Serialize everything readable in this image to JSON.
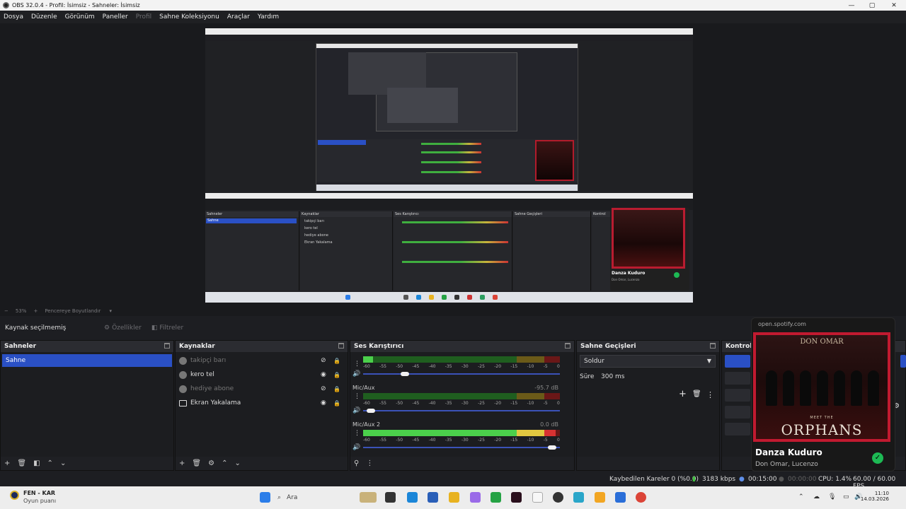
{
  "window": {
    "title": "OBS 32.0.4 - Profil: İsimsiz - Sahneler: İsimsiz",
    "min": "—",
    "max": "▢",
    "close": "✕"
  },
  "menu": [
    "Dosya",
    "Düzenle",
    "Görünüm",
    "Paneller",
    "Profil",
    "Sahne Koleksiyonu",
    "Araçlar",
    "Yardım"
  ],
  "zoom": {
    "minus": "−",
    "value": "53%",
    "plus": "+",
    "fit": "Pencereye Boyutlandır"
  },
  "source_bar": {
    "label": "Kaynak seçilmemiş",
    "properties": "Özellikler",
    "filters": "Filtreler"
  },
  "scenes": {
    "title": "Sahneler",
    "items": [
      "Sahne"
    ]
  },
  "sources": {
    "title": "Kaynaklar",
    "items": [
      {
        "name": "takipçi barı",
        "visible": false
      },
      {
        "name": "kero tel",
        "visible": true
      },
      {
        "name": "hediye abone",
        "visible": false
      },
      {
        "name": "Ekran Yakalama",
        "visible": true
      }
    ]
  },
  "mixer": {
    "title": "Ses Karıştırıcı",
    "ticks": [
      "-60",
      "-55",
      "-50",
      "-45",
      "-40",
      "-35",
      "-30",
      "-25",
      "-20",
      "-15",
      "-10",
      "-5",
      "0"
    ],
    "channels": [
      {
        "name": "",
        "value": "",
        "level": 0.05,
        "volume": 0.2
      },
      {
        "name": "Mic/Aux",
        "value": "-95.7 dB",
        "level": 0.0,
        "volume": 0.02
      },
      {
        "name": "Mic/Aux 2",
        "value": "0.0 dB",
        "level": 0.98,
        "volume": 0.98
      }
    ]
  },
  "transitions": {
    "title": "Sahne Geçişleri",
    "selected": "Soldur",
    "duration_label": "Süre",
    "duration_value": "300 ms"
  },
  "controls": {
    "title": "Kontrol"
  },
  "status": {
    "dropped": "Kaybedilen Kareler 0 (%0.0)",
    "bitrate": "3183 kbps",
    "rec_time": "00:15:00",
    "stream_time": "00:00:00",
    "cpu": "CPU: 1.4%",
    "fps": "60.00 / 60.00 FPS"
  },
  "taskbar": {
    "widget_title": "FEN - KAR",
    "widget_sub": "Oyun puanı",
    "search": "Ara",
    "time": "11:10",
    "date": "14.03.2026"
  },
  "spotify": {
    "url": "open.spotify.com",
    "song": "Danza Kuduro",
    "artist": "Don Omar, Lucenzo",
    "album_top": "DON OMAR",
    "album_sub": "MEET THE",
    "album_title": "ORPHANS"
  },
  "preview_inner": {
    "song": "Danza Kuduro",
    "artist": "Don Omar, Lucenzo"
  },
  "colors": {
    "accent": "#2a50c5",
    "meter_green": "#4bd04b",
    "meter_yellow": "#e2c840",
    "meter_red": "#d83232",
    "spotify_green": "#1db954"
  }
}
